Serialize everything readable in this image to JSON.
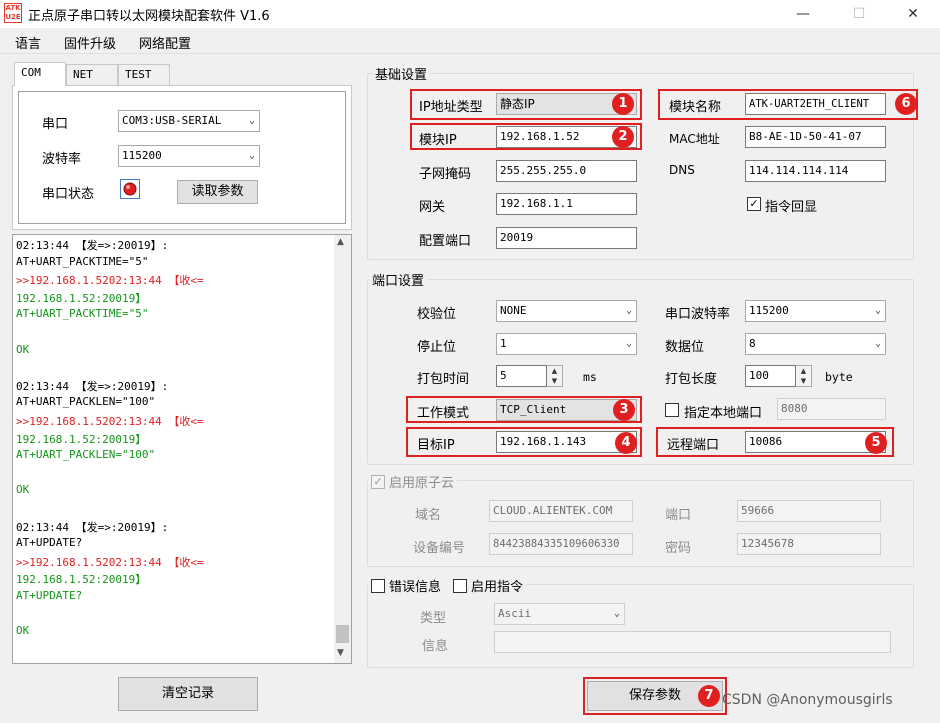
{
  "window": {
    "icon_text": "ATK U2E",
    "title": "正点原子串口转以太网模块配套软件 V1.6",
    "minimize": "—",
    "maximize": "☐",
    "close": "✕"
  },
  "menu": [
    "语言",
    "固件升级",
    "网络配置"
  ],
  "tabs": [
    "COM",
    "NET",
    "TEST"
  ],
  "com": {
    "port_label": "串口",
    "port_value": "COM3:USB-SERIAL",
    "baud_label": "波特率",
    "baud_value": "115200",
    "status_label": "串口状态",
    "read_button": "读取参数"
  },
  "log": [
    {
      "text": "02:13:44 【发=>:20019】:",
      "color": "black"
    },
    {
      "text": "AT+UART_PACKTIME=\"5\"",
      "color": "black"
    },
    {
      "text": ">>192.168.1.5202:13:44 【收<=",
      "color": "red"
    },
    {
      "text": "192.168.1.52:20019】",
      "color": "green"
    },
    {
      "text": "AT+UART_PACKTIME=\"5\"",
      "color": "green"
    },
    {
      "text": "",
      "color": "black"
    },
    {
      "text": "OK",
      "color": "green"
    },
    {
      "text": "",
      "color": "black"
    },
    {
      "text": "02:13:44 【发=>:20019】:",
      "color": "black"
    },
    {
      "text": "AT+UART_PACKLEN=\"100\"",
      "color": "black"
    },
    {
      "text": ">>192.168.1.5202:13:44 【收<=",
      "color": "red"
    },
    {
      "text": "192.168.1.52:20019】",
      "color": "green"
    },
    {
      "text": "AT+UART_PACKLEN=\"100\"",
      "color": "green"
    },
    {
      "text": "",
      "color": "black"
    },
    {
      "text": "OK",
      "color": "green"
    },
    {
      "text": "",
      "color": "black"
    },
    {
      "text": "02:13:44 【发=>:20019】:",
      "color": "black"
    },
    {
      "text": "AT+UPDATE?",
      "color": "black"
    },
    {
      "text": ">>192.168.1.5202:13:44 【收<=",
      "color": "red"
    },
    {
      "text": "192.168.1.52:20019】",
      "color": "green"
    },
    {
      "text": "AT+UPDATE?",
      "color": "green"
    },
    {
      "text": "",
      "color": "black"
    },
    {
      "text": "OK",
      "color": "green"
    }
  ],
  "clear_button": "清空记录",
  "basic": {
    "title": "基础设置",
    "ip_type_label": "IP地址类型",
    "ip_type_value": "静态IP",
    "ip_label": "模块IP",
    "ip_value": "192.168.1.52",
    "mask_label": "子网掩码",
    "mask_value": "255.255.255.0",
    "gateway_label": "网关",
    "gateway_value": "192.168.1.1",
    "config_port_label": "配置端口",
    "config_port_value": "20019",
    "name_label": "模块名称",
    "name_value": "ATK-UART2ETH_CLIENT",
    "mac_label": "MAC地址",
    "mac_value": "B8-AE-1D-50-41-07",
    "dns_label": "DNS",
    "dns_value": "114.114.114.114",
    "echo_label": "指令回显",
    "echo_checked": true
  },
  "port": {
    "title": "端口设置",
    "parity_label": "校验位",
    "parity_value": "NONE",
    "baud_label": "串口波特率",
    "baud_value": "115200",
    "stop_label": "停止位",
    "stop_value": "1",
    "data_label": "数据位",
    "data_value": "8",
    "pack_time_label": "打包时间",
    "pack_time_value": "5",
    "pack_time_unit": "ms",
    "pack_len_label": "打包长度",
    "pack_len_value": "100",
    "pack_len_unit": "byte",
    "mode_label": "工作模式",
    "mode_value": "TCP_Client",
    "local_port_label": "指定本地端口",
    "local_port_value": "8080",
    "target_ip_label": "目标IP",
    "target_ip_value": "192.168.1.143",
    "remote_port_label": "远程端口",
    "remote_port_value": "10086"
  },
  "cloud": {
    "enable_label": "启用原子云",
    "domain_label": "域名",
    "domain_value": "CLOUD.ALIENTEK.COM",
    "port_label": "端口",
    "port_value": "59666",
    "device_label": "设备编号",
    "device_value": "84423884335109606330",
    "password_label": "密码",
    "password_value": "12345678"
  },
  "misc": {
    "error_label": "错误信息",
    "cmd_label": "启用指令",
    "type_label": "类型",
    "type_value": "Ascii",
    "info_label": "信息"
  },
  "save_button": "保存参数",
  "badges": [
    "1",
    "2",
    "3",
    "4",
    "5",
    "6",
    "7"
  ],
  "watermark": "CSDN @Anonymousgirls"
}
